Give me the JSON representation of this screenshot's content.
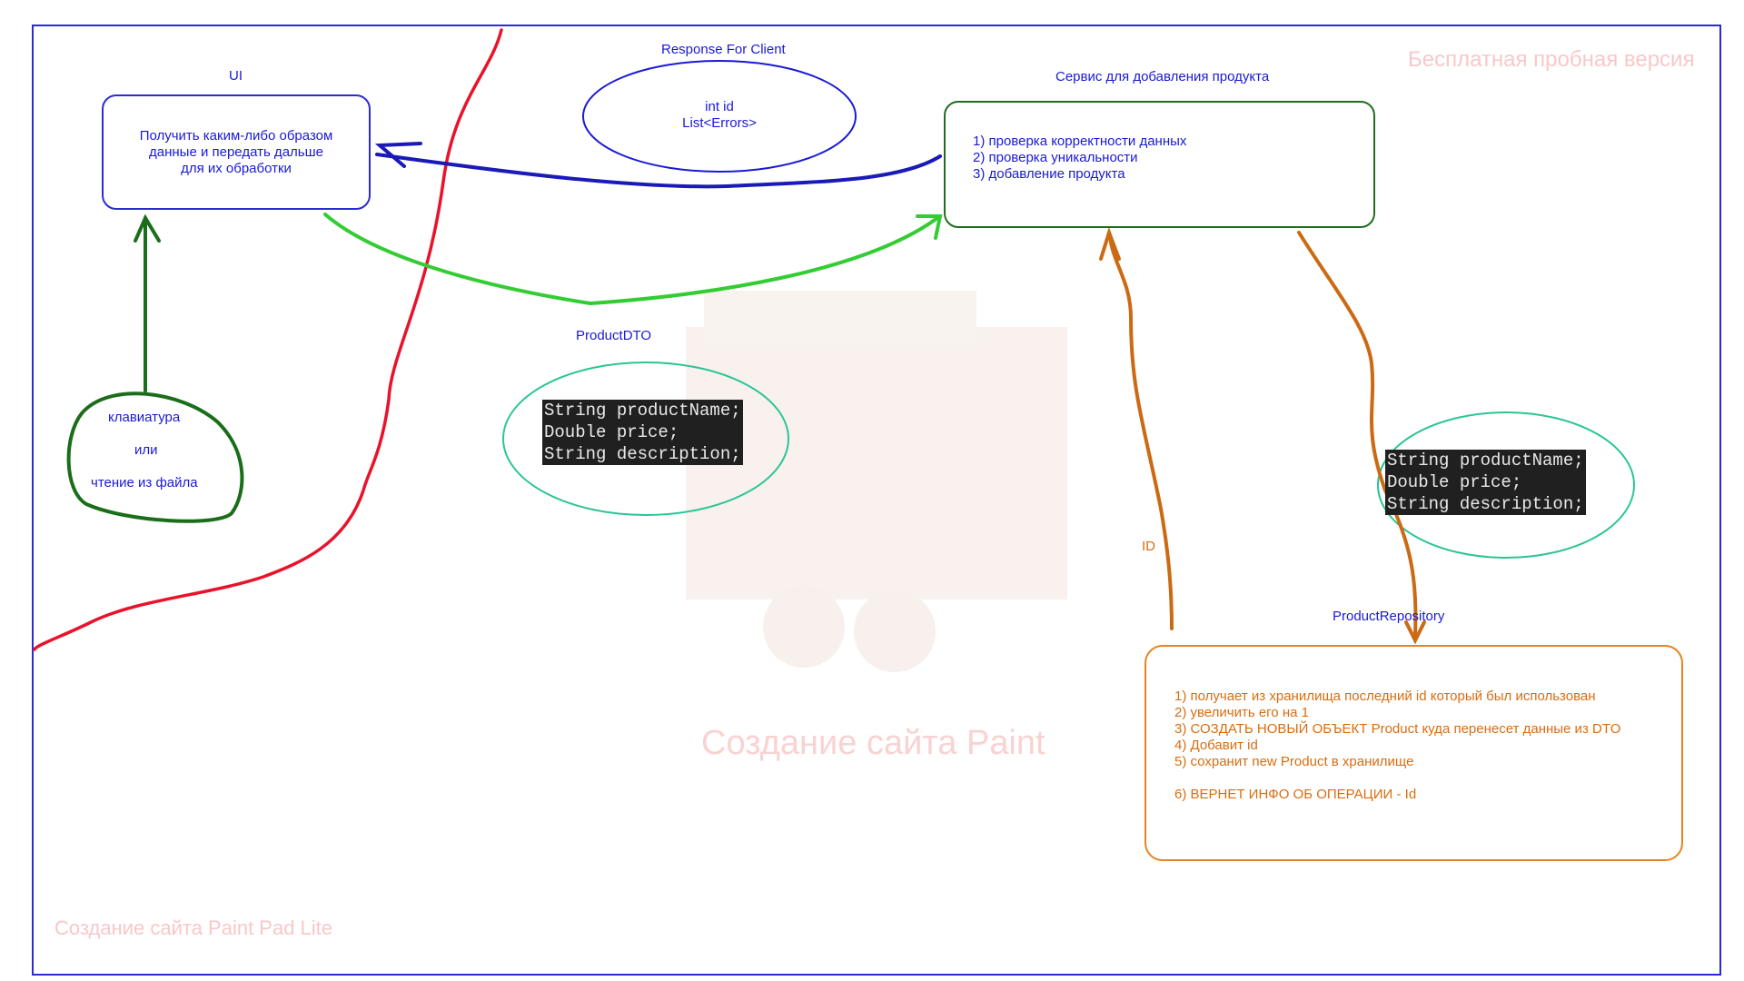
{
  "watermarks": {
    "trial": "Бесплатная пробная версия",
    "site_bottom": "Создание сайта Paint Pad Lite",
    "site_center": "Создание сайта Paint"
  },
  "ui": {
    "title": "UI",
    "lines": [
      "Получить каким-либо образом",
      "данные и передать дальше",
      "для их обработки"
    ]
  },
  "response": {
    "title": "Response For Client",
    "lines": [
      "int id",
      "List<Errors>"
    ]
  },
  "service": {
    "title": "Сервис для добавления продукта",
    "lines": [
      "1) проверка корректности данных",
      "2) проверка уникальности",
      "3) добавление продукта"
    ]
  },
  "input": {
    "lines": [
      "клавиатура",
      "или",
      "чтение из файла"
    ]
  },
  "dto": {
    "title": "ProductDTO",
    "code": [
      "String productName;",
      "Double price;",
      "String description;"
    ]
  },
  "dto2": {
    "code": [
      "String productName;",
      "Double price;",
      "String description;"
    ]
  },
  "id_label": "ID",
  "repository": {
    "title": "ProductRepository",
    "lines": [
      "1) получает из хранилища последний id который был использован",
      "2) увеличить его на 1",
      "3) СОЗДАТЬ НОВЫЙ ОБЪЕКТ Product куда перенесет данные из DTO",
      "4) Добавит id",
      "5) сохранит new Product в хранилище",
      "",
      "6) ВЕРНЕТ ИНФО ОБ ОПЕРАЦИИ - Id"
    ]
  },
  "colors": {
    "blue": "#1a1ad6",
    "red": "#e8132b",
    "green_bright": "#33cc33",
    "green_dark": "#1a6e1a",
    "orange": "#cc6a14",
    "teal": "#2bc596"
  }
}
